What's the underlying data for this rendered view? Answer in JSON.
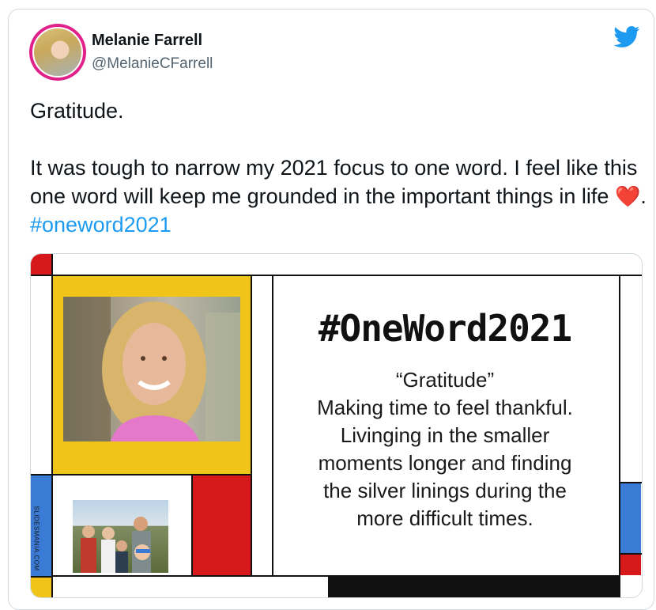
{
  "tweet": {
    "author_name": "Melanie Farrell",
    "handle": "@MelanieCFarrell",
    "line1": "Gratitude.",
    "body_text": "It was tough to narrow my 2021 focus to one word.  I feel like this one word will keep me grounded in the important things in life",
    "heart_emoji": "❤️",
    "period": ". ",
    "hashtag": "#oneword2021",
    "brand_icon": "twitter-bird-icon",
    "colors": {
      "hashtag": "#1d9bf0",
      "twitter_blue": "#1d9bf0",
      "avatar_ring": "#e0218a"
    }
  },
  "slide": {
    "title": "#OneWord2021",
    "quote_lines": [
      "“Gratitude”",
      "Making time to feel thankful.",
      "Livinging in the smaller",
      "moments longer and finding",
      "the silver linings during the",
      "more difficult times."
    ],
    "watermark": "SLIDESMANIA.COM",
    "colors": {
      "yellow": "#f0c419",
      "red": "#d7191c",
      "blue": "#3a7bd5",
      "black": "#111111"
    }
  }
}
